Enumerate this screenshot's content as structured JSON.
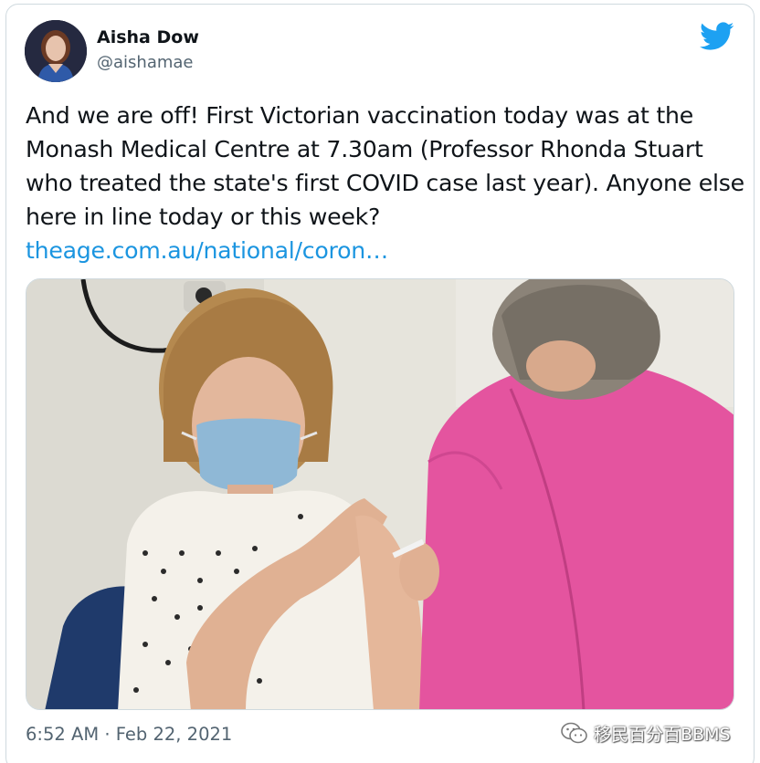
{
  "tweet": {
    "author": {
      "display_name": "Aisha Dow",
      "handle": "@aishamae",
      "avatar_icon": "profile-avatar"
    },
    "platform_icon": "twitter-bird-icon",
    "text": "And we are off! First Victorian vaccination today was at the Monash Medical Centre at 7.30am (Professor Rhonda Stuart who treated the state's first COVID case last year). Anyone else here in line today or this week?",
    "link_text": "theage.com.au/national/coron…",
    "timestamp": "6:52 AM · Feb 22, 2021",
    "colors": {
      "link": "#1b95e0",
      "twitter_blue": "#1da1f2",
      "secondary_text": "#536471"
    }
  },
  "watermark": {
    "text": "移民百分百BBMS",
    "icon": "wechat-icon"
  }
}
